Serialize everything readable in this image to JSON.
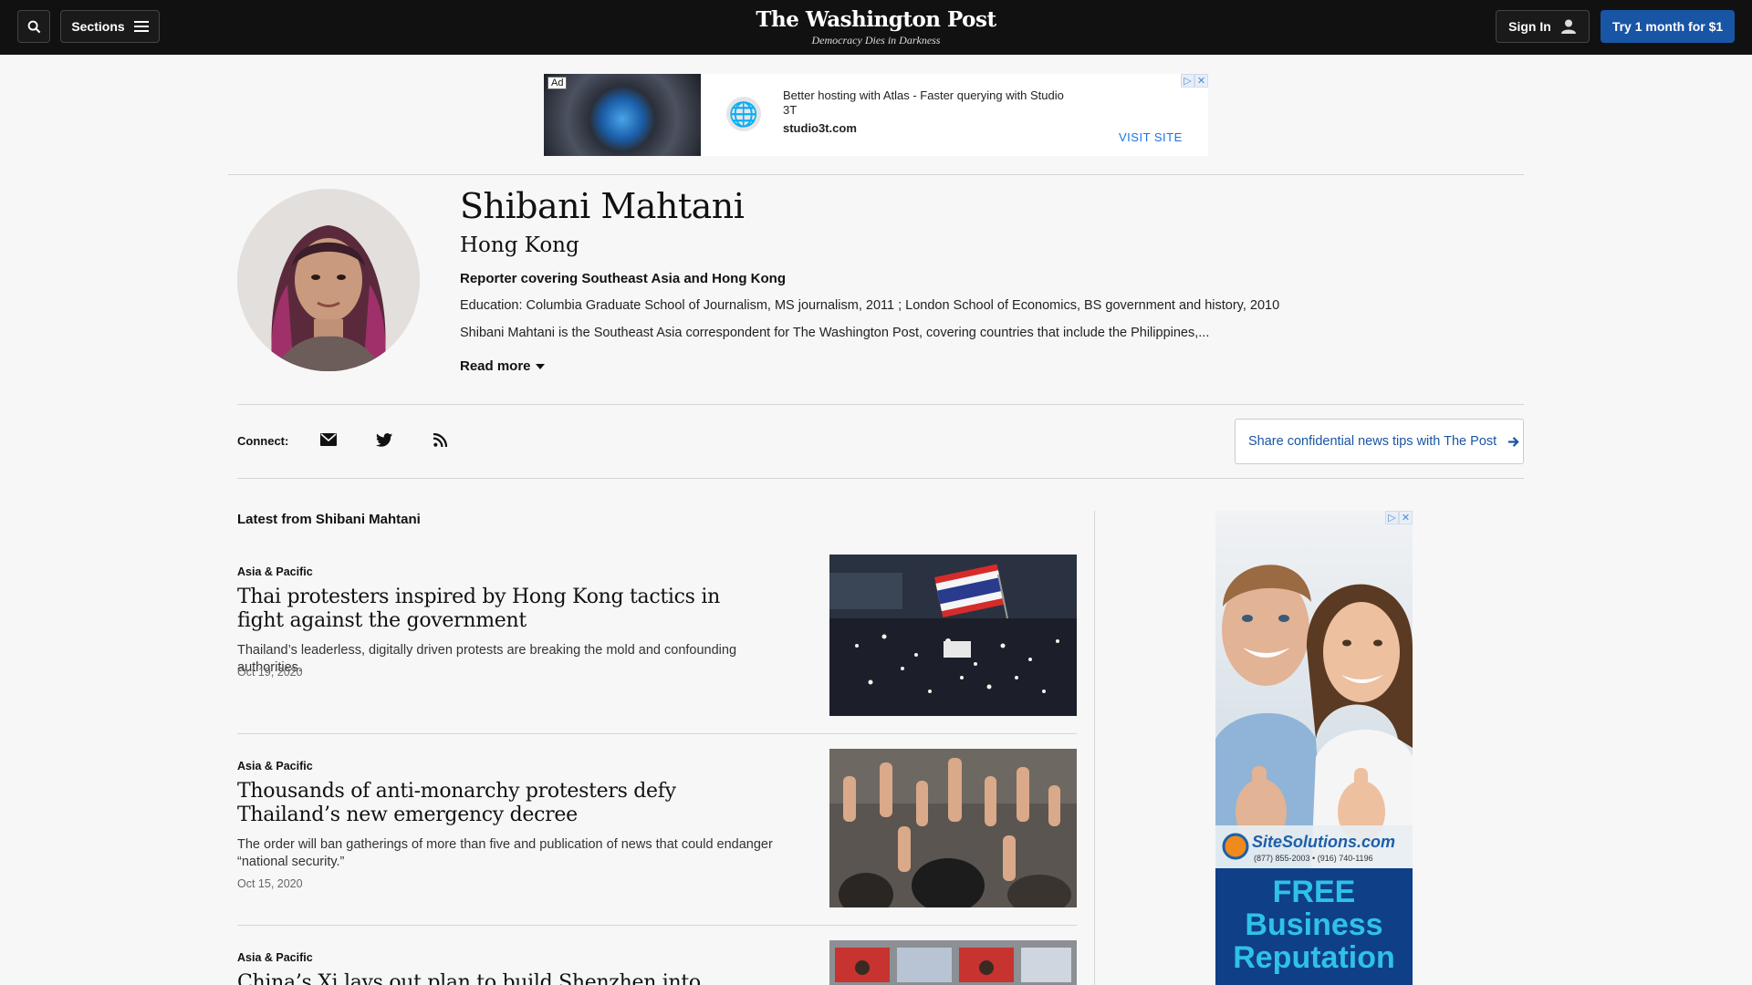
{
  "nav": {
    "sections_label": "Sections",
    "logo": "The Washington Post",
    "tagline": "Democracy Dies in Darkness",
    "signin_label": "Sign In",
    "subscribe_label": "Try 1 month for $1"
  },
  "top_ad": {
    "label": "Ad",
    "text": "Better hosting with Atlas - Faster querying with Studio 3T",
    "domain": "studio3t.com",
    "cta": "VISIT SITE"
  },
  "author": {
    "name": "Shibani Mahtani",
    "location": "Hong Kong",
    "role": "Reporter covering Southeast Asia and Hong Kong",
    "education": "Education: Columbia Graduate School of Journalism, MS journalism, 2011 ; London School of Economics, BS government and history, 2010",
    "bio": "Shibani Mahtani is the Southeast Asia correspondent for The Washington Post, covering countries that include the Philippines,...",
    "read_more": "Read more"
  },
  "connect": {
    "label": "Connect:",
    "icons": [
      "email-icon",
      "twitter-icon",
      "rss-icon"
    ],
    "tips_label": "Share confidential news tips with The Post"
  },
  "latest": {
    "heading": "Latest from Shibani Mahtani",
    "stories": [
      {
        "kicker": "Asia & Pacific",
        "headline": "Thai protesters inspired by Hong Kong tactics in fight against the government",
        "dek": "Thailand’s leaderless, digitally driven protests are breaking the mold and confounding authorities.",
        "date": "Oct 19, 2020"
      },
      {
        "kicker": "Asia & Pacific",
        "headline": "Thousands of anti-monarchy protesters defy Thailand’s new emergency decree",
        "dek": "The order will ban gatherings of more than five and publication of news that could endanger “national security.”",
        "date": "Oct 15, 2020"
      },
      {
        "kicker": "Asia & Pacific",
        "headline": "China’s Xi lays out plan to build Shenzhen into global rival",
        "dek": "",
        "date": ""
      }
    ]
  },
  "side_ad": {
    "brand": "SiteSolutions.com",
    "phone": "(877) 855-2003 • (916) 740-1196",
    "headline_1": "FREE",
    "headline_2": "Business",
    "headline_3": "Reputation"
  },
  "colors": {
    "topbar": "#111111",
    "accent": "#1955a5",
    "background": "#f7f7f7"
  }
}
